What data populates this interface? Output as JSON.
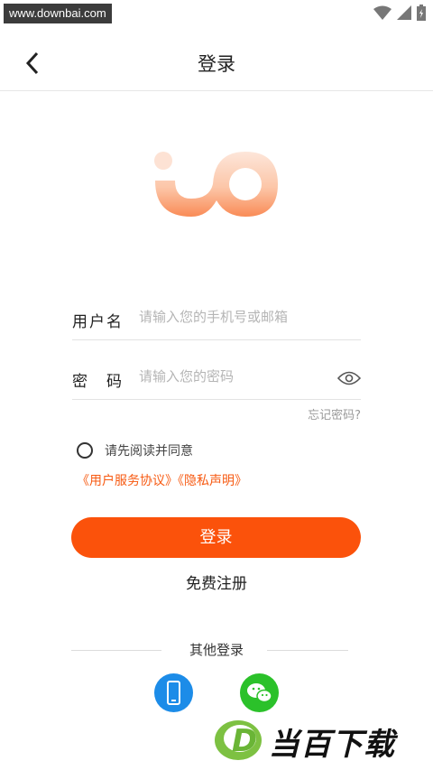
{
  "status_bar": {
    "watermark": "www.downbai.com"
  },
  "header": {
    "title": "登录"
  },
  "form": {
    "username": {
      "label": "用户名",
      "placeholder": "请输入您的手机号或邮箱",
      "value": ""
    },
    "password": {
      "label": "密　码",
      "placeholder": "请输入您的密码",
      "value": ""
    },
    "forgot": "忘记密码?"
  },
  "agreement": {
    "text": "请先阅读并同意",
    "terms": "《用户服务协议》",
    "privacy": "《隐私声明》",
    "checked": false
  },
  "actions": {
    "login": "登录",
    "register": "免费注册"
  },
  "other_login": {
    "label": "其他登录"
  },
  "brand": {
    "logo_letter": "D",
    "name": "当百下载"
  },
  "colors": {
    "accent": "#fb520b",
    "link": "#f75a12",
    "phone": "#1c8ce8",
    "wechat": "#2bc12a"
  }
}
